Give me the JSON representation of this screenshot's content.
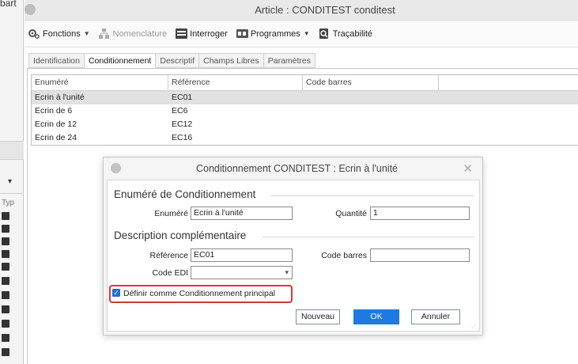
{
  "background": {
    "top_text": "bart",
    "column_label": "Typ"
  },
  "window": {
    "title": "Article : CONDITEST conditest"
  },
  "toolbar": {
    "items": [
      {
        "label": "Fonctions",
        "icon": "gears-icon",
        "has_dropdown": true,
        "enabled": true
      },
      {
        "label": "Nomenclature",
        "icon": "structure-icon",
        "has_dropdown": false,
        "enabled": false
      },
      {
        "label": "Interroger",
        "icon": "query-icon",
        "has_dropdown": false,
        "enabled": true
      },
      {
        "label": "Programmes",
        "icon": "programs-icon",
        "has_dropdown": true,
        "enabled": true
      },
      {
        "label": "Traçabilité",
        "icon": "traceability-icon",
        "has_dropdown": false,
        "enabled": true
      }
    ]
  },
  "tabs": [
    {
      "label": "Identification",
      "active": false
    },
    {
      "label": "Conditionnement",
      "active": true
    },
    {
      "label": "Descriptif",
      "active": false
    },
    {
      "label": "Champs Libres",
      "active": false
    },
    {
      "label": "Paramètres",
      "active": false
    }
  ],
  "grid": {
    "columns": [
      "Enuméré",
      "Référence",
      "Code barres",
      ""
    ],
    "rows": [
      {
        "enumere": "Ecrin à l'unité",
        "reference": "EC01",
        "code_barres": "",
        "selected": true
      },
      {
        "enumere": "Ecrin de 6",
        "reference": "EC6",
        "code_barres": "",
        "selected": false
      },
      {
        "enumere": "Ecrin de 12",
        "reference": "EC12",
        "code_barres": "",
        "selected": false
      },
      {
        "enumere": "Ecrin de 24",
        "reference": "EC16",
        "code_barres": "",
        "selected": false
      }
    ]
  },
  "dialog": {
    "title": "Conditionnement CONDITEST :  Ecrin à l'unité",
    "section1": "Enuméré de Conditionnement",
    "enumere_label": "Enuméré",
    "enumere_value": "Ecrin à l'unité",
    "quantite_label": "Quantité",
    "quantite_value": "1",
    "section2": "Description complémentaire",
    "reference_label": "Référence",
    "reference_value": "EC01",
    "code_barres_label": "Code barres",
    "code_barres_value": "",
    "code_edi_label": "Code EDI",
    "code_edi_value": "",
    "checkbox_label": "Définir comme Conditionnement principal",
    "checkbox_checked": true,
    "buttons": {
      "new": "Nouveau",
      "ok": "OK",
      "cancel": "Annuler"
    }
  },
  "colors": {
    "accent": "#1e7ae0",
    "highlight": "#d23a3a",
    "selected_row": "#e1e1e1"
  }
}
